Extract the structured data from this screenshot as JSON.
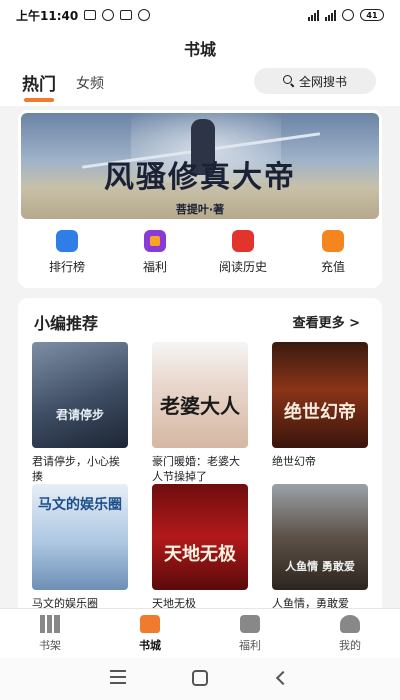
{
  "status_bar": {
    "time": "上午11:40",
    "battery": "41"
  },
  "header": {
    "title": "书城",
    "tabs": [
      {
        "label": "热门"
      },
      {
        "label": "女频"
      }
    ],
    "search_label": "全网搜书"
  },
  "banner": {
    "title": "风骚修真大帝",
    "author": "菩提叶·著"
  },
  "shortcuts": [
    {
      "label": "排行榜",
      "icon": "trophy-icon"
    },
    {
      "label": "福利",
      "icon": "gift-icon"
    },
    {
      "label": "阅读历史",
      "icon": "history-icon"
    },
    {
      "label": "充值",
      "icon": "coin-icon"
    }
  ],
  "recommend": {
    "title": "小编推荐",
    "more": "查看更多 >",
    "books": [
      {
        "title": "君请停步，小心挨揍",
        "cover_text": "君请停步"
      },
      {
        "title": "豪门暖婚：老婆大人节操掉了",
        "cover_text": "老婆大人"
      },
      {
        "title": "绝世幻帝",
        "cover_text": "绝世幻帝"
      },
      {
        "title": "马文的娱乐圈",
        "cover_text": "马文的娱乐圈"
      },
      {
        "title": "天地无极",
        "cover_text": "天地无极"
      },
      {
        "title": "人鱼情，勇敢爱",
        "cover_text": "人鱼情 勇敢爱"
      }
    ]
  },
  "bottom_nav": [
    {
      "label": "书架"
    },
    {
      "label": "书城"
    },
    {
      "label": "福利"
    },
    {
      "label": "我的"
    }
  ]
}
